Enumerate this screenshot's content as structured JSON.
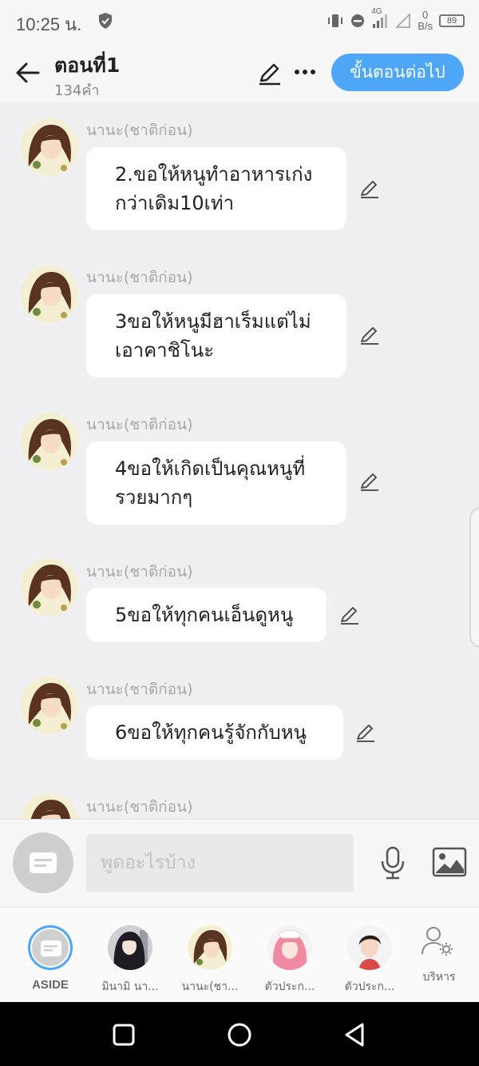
{
  "status_bar": {
    "time": "10:25 น.",
    "network": "4G",
    "speed_value": "0",
    "speed_unit": "B/s",
    "battery": "89"
  },
  "header": {
    "title": "ตอนที่1",
    "subtitle": "134คำ",
    "next_button": "ขั้นตอนต่อไป"
  },
  "messages": [
    {
      "sender": "นานะ(ชาติก่อน)",
      "lines": [
        "2.ขอให้หนูทำอาหารเก่ง",
        "กว่าเดิม10เท่า"
      ]
    },
    {
      "sender": "นานะ(ชาติก่อน)",
      "lines": [
        "3ขอให้หนูมีฮาเร็มแต่ไม่",
        "เอาคาชิโนะ"
      ]
    },
    {
      "sender": "นานะ(ชาติก่อน)",
      "lines": [
        "4ขอให้เกิดเป็นคุณหนูที่",
        "รวยมากๆ"
      ]
    },
    {
      "sender": "นานะ(ชาติก่อน)",
      "lines": [
        "5ขอให้ทุกคนเอ็นดูหนู"
      ]
    },
    {
      "sender": "นานะ(ชาติก่อน)",
      "lines": [
        "6ขอให้ทุกคนรู้จักกับหนู"
      ]
    },
    {
      "sender": "นานะ(ชาติก่อน)",
      "lines": []
    }
  ],
  "input": {
    "placeholder": "พูดอะไรบ้าง"
  },
  "characters": [
    {
      "name": "ASIDE",
      "icon": "aside-icon"
    },
    {
      "name": "มินามิ นา...",
      "icon": "avatar-dark-hair"
    },
    {
      "name": "นานะ(ชา...",
      "icon": "avatar-nana"
    },
    {
      "name": "ตัวประก...",
      "icon": "avatar-pink-hair"
    },
    {
      "name": "ตัวประก...",
      "icon": "avatar-boy"
    },
    {
      "name": "บริหาร",
      "icon": "manage-characters-icon"
    }
  ],
  "colors": {
    "accent": "#4ea7f6",
    "background": "#f0f0f2",
    "bubble": "#ffffff",
    "sender_text": "#a8a8a8"
  }
}
